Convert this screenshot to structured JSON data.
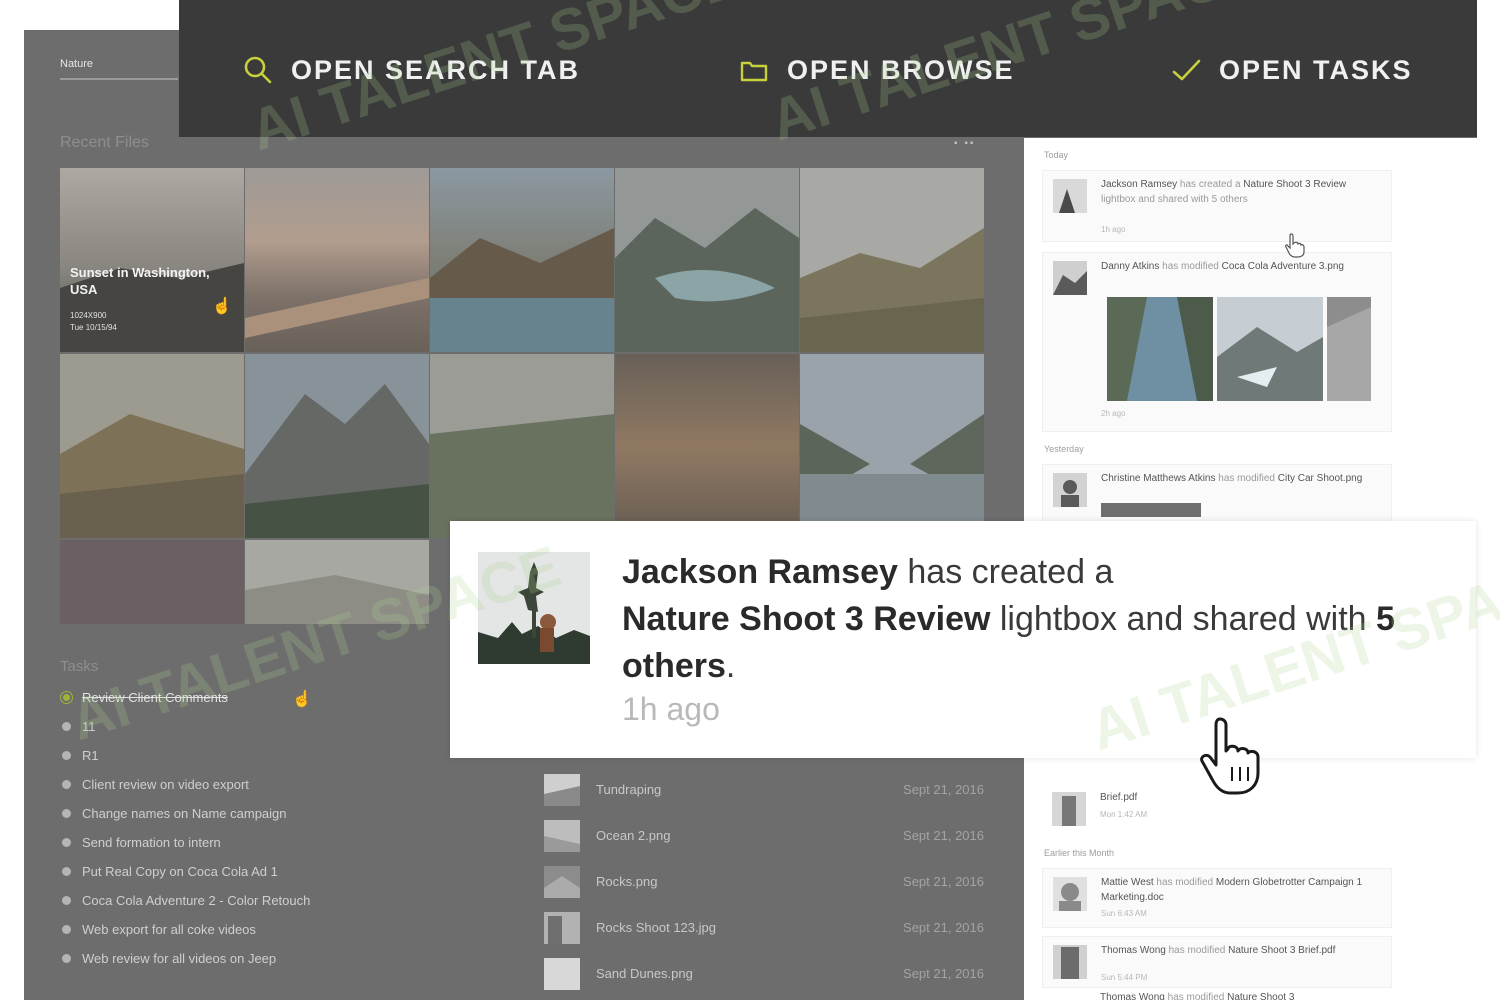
{
  "toolbar": {
    "search_label": "OPEN SEARCH TAB",
    "browse_label": "OPEN BROWSE",
    "tasks_label": "OPEN TASKS",
    "accent_color": "#c7d13c"
  },
  "app": {
    "search_value": "Nature",
    "recent_files_title": "Recent Files",
    "tasks_title": "Tasks"
  },
  "featured_tile": {
    "title": "Sunset in Washington, USA",
    "line1": "1024X900",
    "line2": "Tue 10/15/94"
  },
  "tasks": [
    {
      "label": "Review Client Comments",
      "done": true
    },
    {
      "label": "11",
      "done": false
    },
    {
      "label": "R1",
      "done": false
    },
    {
      "label": "Client review on video export",
      "done": false
    },
    {
      "label": "Change names on Name campaign",
      "done": false
    },
    {
      "label": "Send formation to intern",
      "done": false
    },
    {
      "label": "Put Real Copy on Coca Cola Ad 1",
      "done": false
    },
    {
      "label": "Coca Cola Adventure 2 - Color Retouch",
      "done": false
    },
    {
      "label": "Web export for all coke videos",
      "done": false
    },
    {
      "label": "Web review for all videos on Jeep",
      "done": false
    }
  ],
  "files": [
    {
      "name": "Tundraping",
      "date": "Sept 21, 2016"
    },
    {
      "name": "Ocean 2.png",
      "date": "Sept 21, 2016"
    },
    {
      "name": "Rocks.png",
      "date": "Sept 21, 2016"
    },
    {
      "name": "Rocks Shoot 123.jpg",
      "date": "Sept 21, 2016"
    },
    {
      "name": "Sand Dunes.png",
      "date": "Sept 21, 2016"
    }
  ],
  "activity": {
    "today_label": "Today",
    "yesterday_label": "Yesterday",
    "earlier_label": "Earlier this Month",
    "items": [
      {
        "actor": "Jackson Ramsey",
        "text": " has created a ",
        "object": "Nature Shoot 3 Review",
        "tail": " lightbox and shared with 5 others",
        "time": "1h ago"
      },
      {
        "actor": "Danny Atkins",
        "text": " has modified ",
        "object": "Coca Cola Adventure 3.png",
        "tail": "",
        "time": "2h ago"
      },
      {
        "actor": "Christine Matthews Atkins",
        "text": " has modified ",
        "object": "City Car Shoot.png",
        "tail": "",
        "time": ""
      },
      {
        "actor": "",
        "text": "",
        "object": "Brief.pdf",
        "tail": "",
        "time": "Mon 1:42 AM"
      },
      {
        "actor": "Mattie West",
        "text": " has modified ",
        "object": "Modern Globetrotter Campaign 1 Marketing.doc",
        "tail": "",
        "time": "Sun 6:43 AM"
      },
      {
        "actor": "Thomas Wong",
        "text": " has modified ",
        "object": "Nature Shoot 3 Brief.pdf",
        "tail": "",
        "time": "Sun 5:44 PM"
      },
      {
        "actor": "Thomas Wong",
        "text": " has modified ",
        "object": "Nature Shoot 3",
        "tail": "",
        "time": ""
      }
    ]
  },
  "popup": {
    "actor": "Jackson Ramsey",
    "verb": " has created a",
    "object": "Nature Shoot 3 Review",
    "mid": " lightbox and shared with ",
    "count": "5 others",
    "end": ".",
    "time": "1h ago"
  },
  "watermark_text": "AI TALENT SPACE"
}
